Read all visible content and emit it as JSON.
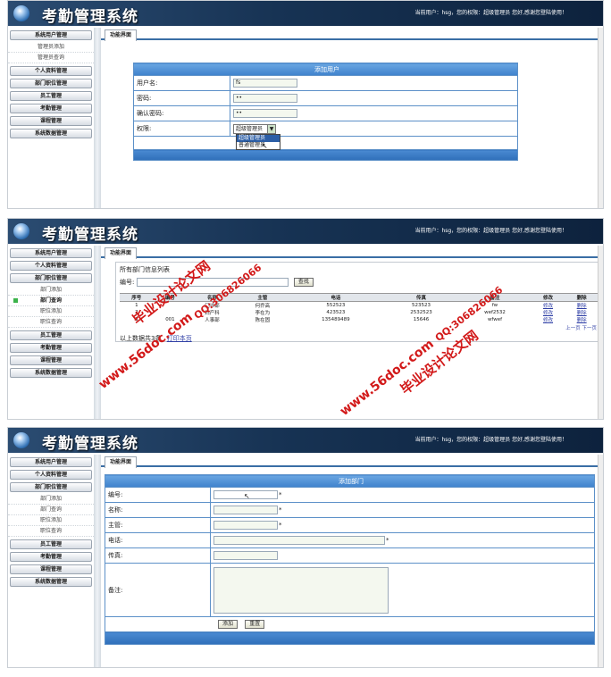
{
  "app": {
    "title": "考勤管理系统",
    "user_info": "当前用户：hsg，您的权限：超级管理员  您好,感谢您登陆使用！"
  },
  "panel1": {
    "sidebar": [
      {
        "label": "系统用户管理",
        "type": "head"
      },
      {
        "label": "管理员添加",
        "type": "sub"
      },
      {
        "label": "管理员查询",
        "type": "sub"
      },
      {
        "label": "个人资料管理",
        "type": "head"
      },
      {
        "label": "部门职位管理",
        "type": "head"
      },
      {
        "label": "员工管理",
        "type": "head"
      },
      {
        "label": "考勤管理",
        "type": "head"
      },
      {
        "label": "课程管理",
        "type": "head"
      },
      {
        "label": "系统数据管理",
        "type": "head"
      }
    ],
    "tab_label": "功能界面",
    "form_title": "添加用户",
    "username_label": "用户名:",
    "username_value": "fs",
    "password_label": "密码:",
    "password_value": "••",
    "confirm_label": "确认密码:",
    "confirm_value": "••",
    "permission_label": "权限:",
    "permission_selected": "超级管理员",
    "permission_options": [
      "超级管理员",
      "普通管理员"
    ]
  },
  "panel2": {
    "sidebar": [
      {
        "label": "系统用户管理",
        "type": "head"
      },
      {
        "label": "个人资料管理",
        "type": "head"
      },
      {
        "label": "部门职位管理",
        "type": "head"
      },
      {
        "label": "部门添加",
        "type": "sub"
      },
      {
        "label": "部门查询",
        "type": "sub-active"
      },
      {
        "label": "职位添加",
        "type": "sub"
      },
      {
        "label": "职位查询",
        "type": "sub"
      },
      {
        "label": "员工管理",
        "type": "head"
      },
      {
        "label": "考勤管理",
        "type": "head"
      },
      {
        "label": "课程管理",
        "type": "head"
      },
      {
        "label": "系统数据管理",
        "type": "head"
      }
    ],
    "tab_label": "功能界面",
    "list_title": "所有部门信息列表",
    "search_label": "编号:",
    "search_button": "查找",
    "columns": [
      "序号",
      "编号",
      "名称",
      "主管",
      "电话",
      "传真",
      "备注",
      "修改",
      "删除"
    ],
    "rows": [
      [
        "1",
        "",
        "门诊部",
        "何乔高",
        "552523",
        "523523",
        "fw",
        "修改",
        "删除"
      ],
      [
        "2",
        "",
        "妇产科",
        "李在为",
        "423523",
        "2532523",
        "wef2532",
        "修改",
        "删除"
      ],
      [
        "3",
        "001",
        "人事部",
        "陈在固",
        "135489489",
        "15646",
        "wfwef",
        "修改",
        "删除"
      ]
    ],
    "pager_prev": "上一页",
    "pager_next": "下一页",
    "footer_prefix": "以上数据",
    "footer_count": "共3条",
    "print_label": "打印本页",
    "watermark_site": "www.56doc.com",
    "watermark_qq": "QQ:306826066",
    "watermark_name": "毕业设计论文网"
  },
  "panel3": {
    "sidebar": [
      {
        "label": "系统用户管理",
        "type": "head"
      },
      {
        "label": "个人资料管理",
        "type": "head"
      },
      {
        "label": "部门职位管理",
        "type": "head"
      },
      {
        "label": "部门添加",
        "type": "sub"
      },
      {
        "label": "部门查询",
        "type": "sub"
      },
      {
        "label": "职位添加",
        "type": "sub"
      },
      {
        "label": "职位查询",
        "type": "sub"
      },
      {
        "label": "员工管理",
        "type": "head"
      },
      {
        "label": "考勤管理",
        "type": "head"
      },
      {
        "label": "课程管理",
        "type": "head"
      },
      {
        "label": "系统数据管理",
        "type": "head"
      }
    ],
    "tab_label": "功能界面",
    "form_title": "添加部门",
    "id_label": "编号:",
    "name_label": "名称:",
    "manager_label": "主管:",
    "phone_label": "电话:",
    "fax_label": "传真:",
    "remark_label": "备注:",
    "required_mark": "*",
    "add_button": "添加",
    "reset_button": "重置"
  }
}
